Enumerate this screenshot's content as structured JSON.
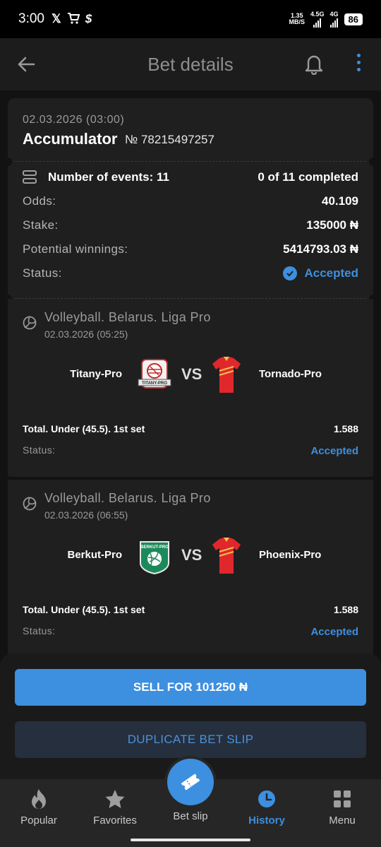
{
  "status_bar": {
    "time": "3:00",
    "icons": [
      "x-icon",
      "cart-icon",
      "dollar-icon"
    ],
    "speed_top": "1.35",
    "speed_bottom": "MB/S",
    "net1": "4.5G",
    "net2": "4G",
    "battery": "86"
  },
  "header": {
    "title": "Bet details"
  },
  "bet": {
    "date": "02.03.2026 (03:00)",
    "type": "Accumulator",
    "number": "№ 78215497257",
    "events_label": "Number of events: 11",
    "completed": "0 of 11 completed",
    "odds_label": "Odds:",
    "odds_value": "40.109",
    "stake_label": "Stake:",
    "stake_value": "135000 ₦",
    "winnings_label": "Potential winnings:",
    "winnings_value": "5414793.03 ₦",
    "status_label": "Status:",
    "status_value": "Accepted"
  },
  "events": [
    {
      "league": "Volleyball. Belarus. Liga Pro",
      "date": "02.03.2026 (05:25)",
      "team1": "Titany-Pro",
      "team2": "Tornado-Pro",
      "team1_logo": "TITANY-PRO",
      "vs": "VS",
      "market": "Total. Under (45.5). 1st set",
      "coef": "1.588",
      "status_label": "Status:",
      "status_value": "Accepted"
    },
    {
      "league": "Volleyball. Belarus. Liga Pro",
      "date": "02.03.2026 (06:55)",
      "team1": "Berkut-Pro",
      "team2": "Phoenix-Pro",
      "team1_logo": "BERKUT-PRO",
      "vs": "VS",
      "market": "Total. Under (45.5). 1st set",
      "coef": "1.588",
      "status_label": "Status:",
      "status_value": "Accepted"
    }
  ],
  "actions": {
    "sell": "SELL FOR 101250 ₦",
    "duplicate": "DUPLICATE BET SLIP"
  },
  "tabs": [
    {
      "label": "Popular",
      "icon": "flame-icon"
    },
    {
      "label": "Favorites",
      "icon": "star-icon"
    },
    {
      "label": "Bet slip",
      "icon": "ticket-icon"
    },
    {
      "label": "History",
      "icon": "clock-icon"
    },
    {
      "label": "Menu",
      "icon": "grid-icon"
    }
  ],
  "colors": {
    "accent": "#3d8fe0",
    "background": "#121212",
    "card": "#1f1f1f"
  }
}
